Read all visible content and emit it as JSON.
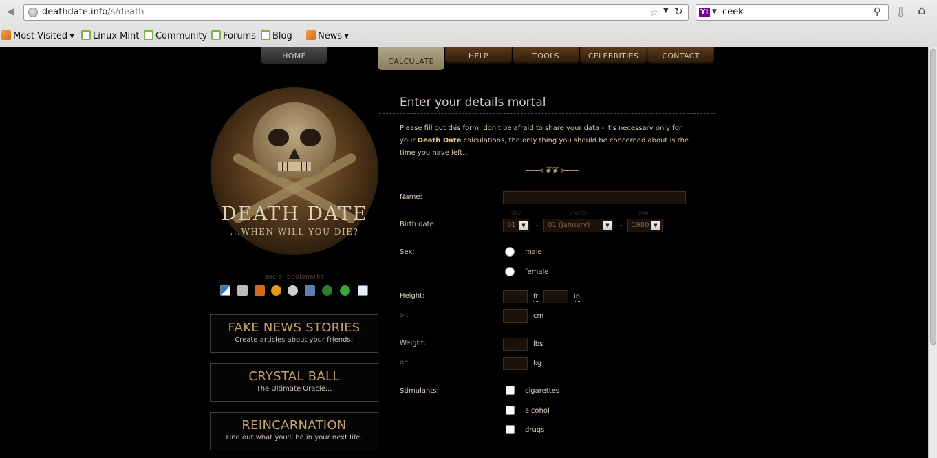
{
  "browser": {
    "url_host": "deathdate.info",
    "url_path": "/s/death",
    "search_text": "ceek",
    "bookmarks": [
      "Most Visited",
      "Linux Mint",
      "Community",
      "Forums",
      "Blog",
      "News"
    ]
  },
  "nav": {
    "home": "HOME",
    "calculate": "CALCULATE",
    "help": "HELP",
    "tools": "TOOLS",
    "celebrities": "CELEBRITIES",
    "contact": "CONTACT"
  },
  "logo": {
    "title": "DEATH DATE",
    "subtitle": "...WHEN WILL YOU DIE?"
  },
  "social": {
    "label": "social bookmarks",
    "icons": [
      "delicious-icon",
      "digg-icon",
      "furl-icon",
      "blinklist-icon",
      "reddit-icon",
      "newsvine-icon",
      "stumbleupon-icon",
      "technorati-icon",
      "google-icon"
    ]
  },
  "promos": [
    {
      "title": "FAKE NEWS STORIES",
      "subtitle": "Create articles about your friends!"
    },
    {
      "title": "CRYSTAL BALL",
      "subtitle": "The Ultimate Oracle..."
    },
    {
      "title": "REINCARNATION",
      "subtitle": "Find out what you'll be in your next life."
    }
  ],
  "form": {
    "title": "Enter your details mortal",
    "intro_before": "Please fill out this form, don't be afraid to share your data - it's necessary only for your ",
    "intro_bold": "Death Date",
    "intro_after": " calculations, the only thing you should be concerned about is the time you have left...",
    "name_label": "Name:",
    "birth_label": "Birth date:",
    "hint_day": "day",
    "hint_month": "month",
    "hint_year": "year",
    "day_value": "01",
    "month_value": "01 (january)",
    "year_value": "1980",
    "date_sep": "-",
    "sex_label": "Sex:",
    "sex_options": [
      "male",
      "female"
    ],
    "height_label": "Height:",
    "or_label": "or:",
    "unit_ft": "ft",
    "unit_in": "in",
    "unit_cm": "cm",
    "weight_label": "Weight:",
    "unit_lbs": "lbs",
    "unit_kg": "kg",
    "stimulants_label": "Stimulants:",
    "stimulants": [
      "cigarettes",
      "alcohol",
      "drugs"
    ]
  }
}
